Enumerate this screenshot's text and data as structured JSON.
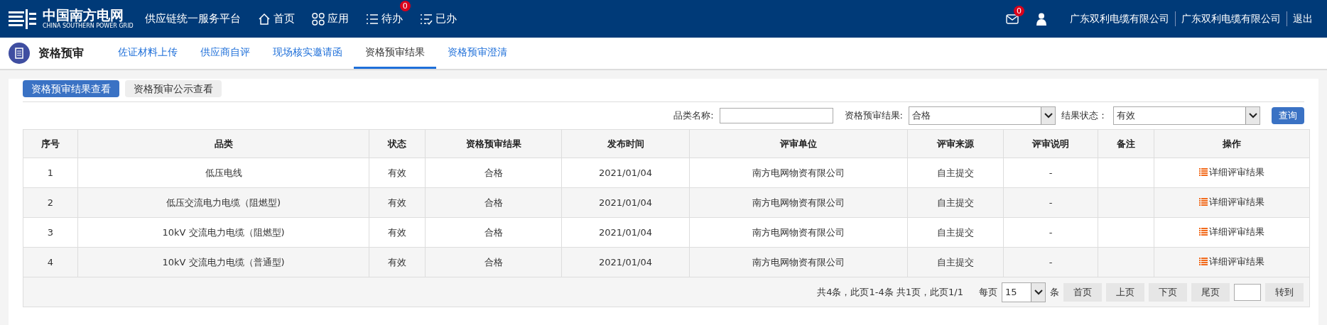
{
  "header": {
    "logo": {
      "name": "中国南方电网",
      "subtitle": "CHINA SOUTHERN POWER GRID"
    },
    "platform": "供应链统一服务平台",
    "nav": [
      {
        "label": "首页",
        "kind": "home"
      },
      {
        "label": "应用",
        "kind": "apps"
      },
      {
        "label": "待办",
        "kind": "todo",
        "badge": "0"
      },
      {
        "label": "已办",
        "kind": "done"
      }
    ],
    "mail_badge": "0",
    "user_links": [
      "广东双利电缆有限公司",
      "广东双利电缆有限公司",
      "退出"
    ]
  },
  "module": {
    "title": "资格预审",
    "tabs": [
      {
        "label": "佐证材料上传",
        "selected": false
      },
      {
        "label": "供应商自评",
        "selected": false
      },
      {
        "label": "现场核实邀请函",
        "selected": false
      },
      {
        "label": "资格预审结果",
        "selected": true
      },
      {
        "label": "资格预审澄清",
        "selected": false
      }
    ]
  },
  "view_buttons": [
    {
      "label": "资格预审结果查看",
      "selected": true
    },
    {
      "label": "资格预审公示查看",
      "selected": false
    }
  ],
  "filters": {
    "category_label": "品类名称:",
    "result_label": "资格预审结果:",
    "result_value": "合格",
    "status_label": "结果状态：",
    "status_value": "有效",
    "query": "查询"
  },
  "table": {
    "columns": [
      "序号",
      "品类",
      "状态",
      "资格预审结果",
      "发布时间",
      "评审单位",
      "评审来源",
      "评审说明",
      "备注",
      "操作"
    ],
    "rows": [
      {
        "cells": [
          "1",
          "低压电线",
          "有效",
          "合格",
          "2021/01/04",
          "南方电网物资有限公司",
          "自主提交",
          "-",
          ""
        ],
        "action": "详细评审结果"
      },
      {
        "cells": [
          "2",
          "低压交流电力电缆（阻燃型)",
          "有效",
          "合格",
          "2021/01/04",
          "南方电网物资有限公司",
          "自主提交",
          "-",
          ""
        ],
        "action": "详细评审结果"
      },
      {
        "cells": [
          "3",
          "10kV 交流电力电缆（阻燃型)",
          "有效",
          "合格",
          "2021/01/04",
          "南方电网物资有限公司",
          "自主提交",
          "-",
          ""
        ],
        "action": "详细评审结果"
      },
      {
        "cells": [
          "4",
          "10kV 交流电力电缆（普通型)",
          "有效",
          "合格",
          "2021/01/04",
          "南方电网物资有限公司",
          "自主提交",
          "-",
          ""
        ],
        "action": "详细评审结果"
      }
    ]
  },
  "pager": {
    "summary": "共4条，此页1-4条 共1页，此页1/1",
    "per_page_label": "每页",
    "per_page": "15",
    "unit": "条",
    "buttons": [
      "首页",
      "上页",
      "下页",
      "尾页"
    ],
    "go": "转到"
  }
}
